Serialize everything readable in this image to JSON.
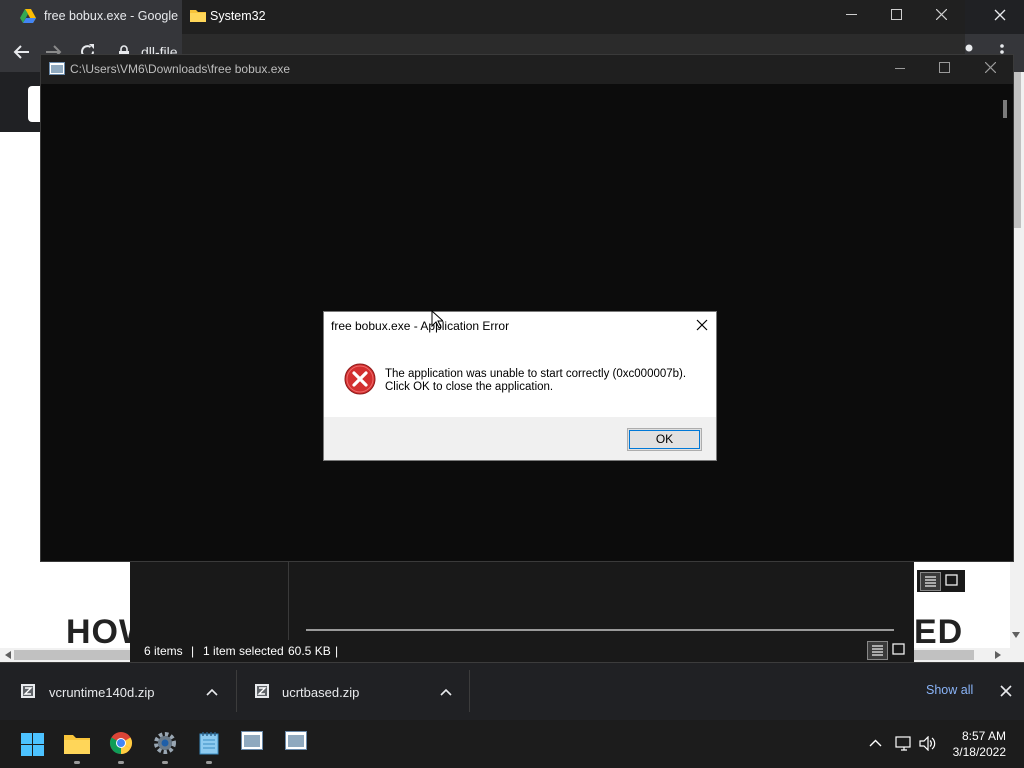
{
  "chrome": {
    "tab_title": "free bobux.exe - Google D",
    "url_text": "dll-file"
  },
  "explorer": {
    "title": "System32",
    "status": {
      "items": "6 items",
      "separator": "|",
      "selected": "1 item selected",
      "size": "60.5 KB"
    }
  },
  "console": {
    "title": "C:\\Users\\VM6\\Downloads\\free bobux.exe"
  },
  "dialog": {
    "title": "free bobux.exe - Application Error",
    "message_line1": "The application was unable to start correctly (0xc000007b).",
    "message_line2": "Click OK to close the application.",
    "ok_label": "OK",
    "icon": "error-icon"
  },
  "page": {
    "headline_left": "HOW",
    "headline_right": "ED"
  },
  "downloads": {
    "items": [
      {
        "name": "vcruntime140d.zip"
      },
      {
        "name": "ucrtbased.zip"
      }
    ],
    "show_all_label": "Show all"
  },
  "taskbar": {
    "apps": [
      "start-icon",
      "file-explorer-icon",
      "chrome-icon",
      "settings-icon",
      "notepad-icon",
      "console-app-icon",
      "console-app-icon-2"
    ],
    "time": "8:57 AM",
    "date": "3/18/2022"
  },
  "colors": {
    "accent": "#0078d7",
    "error_red": "#d32f2f",
    "link_blue": "#8ab4f8"
  }
}
